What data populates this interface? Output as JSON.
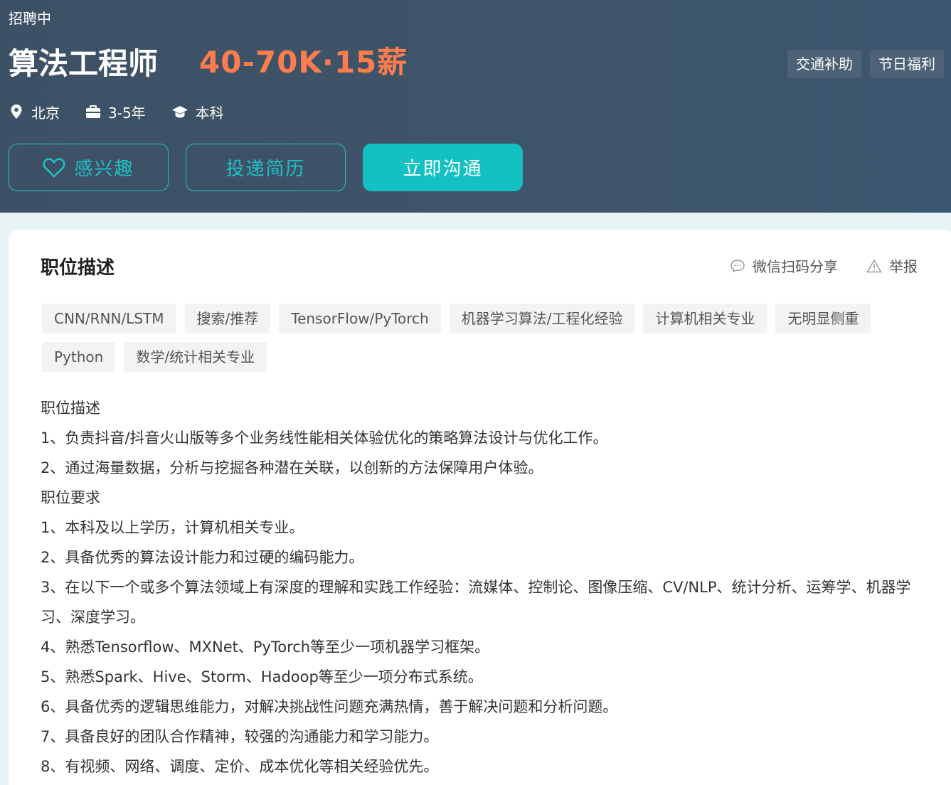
{
  "job": {
    "status": "招聘中",
    "title": "算法工程师",
    "salary": "40-70K·15薪",
    "benefits": [
      "交通补助",
      "节日福利"
    ],
    "location": "北京",
    "experience": "3-5年",
    "education": "本科"
  },
  "buttons": {
    "interest": "感兴趣",
    "apply": "投递简历",
    "chat": "立即沟通"
  },
  "card": {
    "title": "职位描述",
    "share": "微信扫码分享",
    "report": "举报",
    "tags": [
      "CNN/RNN/LSTM",
      "搜索/推荐",
      "TensorFlow/PyTorch",
      "机器学习算法/工程化经验",
      "计算机相关专业",
      "无明显侧重",
      "Python",
      "数学/统计相关专业"
    ],
    "lines": [
      "职位描述",
      "1、负责抖音/抖音火山版等多个业务线性能相关体验优化的策略算法设计与优化工作。",
      "2、通过海量数据，分析与挖掘各种潜在关联，以创新的方法保障用户体验。",
      "职位要求",
      "1、本科及以上学历，计算机相关专业。",
      "2、具备优秀的算法设计能力和过硬的编码能力。",
      "3、在以下一个或多个算法领域上有深度的理解和实践工作经验：流媒体、控制论、图像压缩、CV/NLP、统计分析、运筹学、机器学习、深度学习。",
      "4、熟悉Tensorflow、MXNet、PyTorch等至少一项机器学习框架。",
      "5、熟悉Spark、Hive、Storm、Hadoop等至少一项分布式系统。",
      "6、具备优秀的逻辑思维能力，对解决挑战性问题充满热情，善于解决问题和分析问题。",
      "7、具备良好的团队合作精神，较强的沟通能力和学习能力。",
      "8、有视频、网络、调度、定价、成本优化等相关经验优先。"
    ]
  },
  "colors": {
    "header_bg": "#3e5468",
    "salary": "#ff7d4d",
    "accent": "#13c0c4"
  },
  "icons": {
    "location": "location-pin-icon",
    "experience": "briefcase-icon",
    "education": "graduation-cap-icon",
    "interest": "heart-icon",
    "share": "chat-bubble-icon",
    "report": "warning-triangle-icon"
  }
}
